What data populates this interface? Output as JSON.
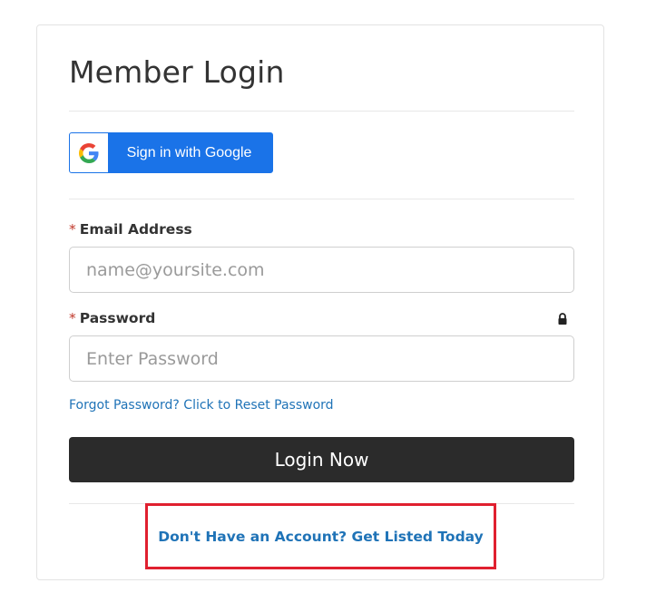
{
  "login_card": {
    "title": "Member Login",
    "google_button_label": "Sign in with Google",
    "email": {
      "required_marker": "*",
      "label": "Email Address",
      "placeholder": "name@yoursite.com",
      "value": ""
    },
    "password": {
      "required_marker": "*",
      "label": "Password",
      "placeholder": "Enter Password",
      "value": "",
      "icon": "lock-icon"
    },
    "forgot_link": "Forgot Password? Click to Reset Password",
    "login_button_label": "Login Now",
    "signup_link": "Don't Have an Account? Get Listed Today"
  },
  "colors": {
    "google_blue": "#1a73e8",
    "link_blue": "#1f73b7",
    "login_button_bg": "#2b2b2b",
    "required_red": "#c0392b",
    "highlight_red": "#e0202f"
  }
}
